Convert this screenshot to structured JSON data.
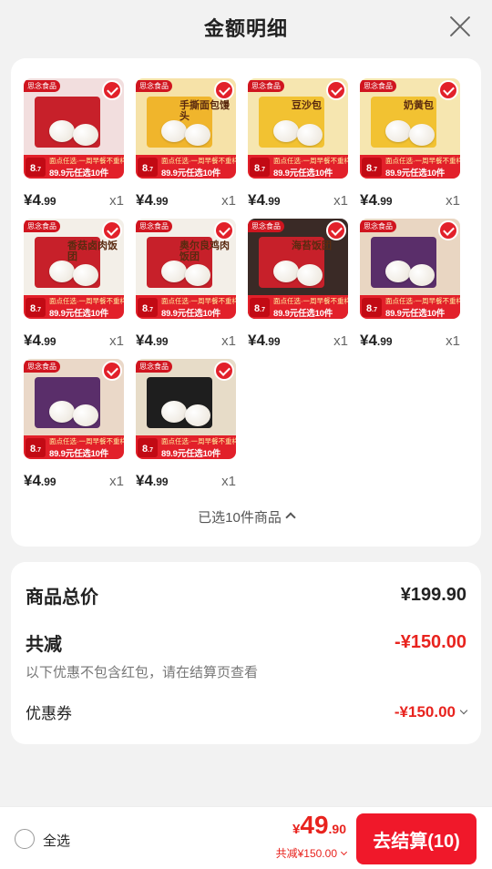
{
  "header": {
    "title": "金额明细"
  },
  "products": [
    {
      "brand": "思念食品",
      "pkg_label": "",
      "pkg_color": "#c7202a",
      "bg": "#f2dede",
      "price_tag": "8",
      "price_tag_dec": ".7",
      "promo_line1": "面点任选·一周早餐不重样",
      "promo_line2": "89.9元任选10件",
      "price_int": "¥4",
      "price_dec": ".99",
      "qty": "x1"
    },
    {
      "brand": "思念食品",
      "pkg_label": "手撕面包馒头",
      "pkg_color": "#f0b52c",
      "bg": "#f6e2a8",
      "price_tag": "8",
      "price_tag_dec": ".7",
      "promo_line1": "面点任选·一周早餐不重样",
      "promo_line2": "89.9元任选10件",
      "price_int": "¥4",
      "price_dec": ".99",
      "qty": "x1"
    },
    {
      "brand": "思念食品",
      "pkg_label": "豆沙包",
      "pkg_color": "#f2c232",
      "bg": "#f6e6b0",
      "price_tag": "8",
      "price_tag_dec": ".7",
      "promo_line1": "面点任选·一周早餐不重样",
      "promo_line2": "89.9元任选10件",
      "price_int": "¥4",
      "price_dec": ".99",
      "qty": "x1"
    },
    {
      "brand": "思念食品",
      "pkg_label": "奶黄包",
      "pkg_color": "#f2c232",
      "bg": "#f6e6b0",
      "price_tag": "8",
      "price_tag_dec": ".7",
      "promo_line1": "面点任选·一周早餐不重样",
      "promo_line2": "89.9元任选10件",
      "price_int": "¥4",
      "price_dec": ".99",
      "qty": "x1"
    },
    {
      "brand": "思念食品",
      "pkg_label": "香菇卤肉饭团",
      "pkg_color": "#c7202a",
      "bg": "#f3efe8",
      "price_tag": "8",
      "price_tag_dec": ".7",
      "promo_line1": "面点任选·一周早餐不重样",
      "promo_line2": "89.9元任选10件",
      "price_int": "¥4",
      "price_dec": ".99",
      "qty": "x1"
    },
    {
      "brand": "思念食品",
      "pkg_label": "奥尔良鸡肉饭团",
      "pkg_color": "#c7202a",
      "bg": "#f3efe8",
      "price_tag": "8",
      "price_tag_dec": ".7",
      "promo_line1": "面点任选·一周早餐不重样",
      "promo_line2": "89.9元任选10件",
      "price_int": "¥4",
      "price_dec": ".99",
      "qty": "x1"
    },
    {
      "brand": "思念食品",
      "pkg_label": "海苔饭团",
      "pkg_color": "#c7202a",
      "bg": "#3a2a26",
      "price_tag": "8",
      "price_tag_dec": ".7",
      "promo_line1": "面点任选·一周早餐不重样",
      "promo_line2": "89.9元任选10件",
      "price_int": "¥4",
      "price_dec": ".99",
      "qty": "x1"
    },
    {
      "brand": "思念食品",
      "pkg_label": "",
      "pkg_color": "#5a2e6a",
      "bg": "#e9d6c2",
      "price_tag": "8",
      "price_tag_dec": ".7",
      "promo_line1": "面点任选·一周早餐不重样",
      "promo_line2": "89.9元任选10件",
      "price_int": "¥4",
      "price_dec": ".99",
      "qty": "x1"
    },
    {
      "brand": "思念食品",
      "pkg_label": "",
      "pkg_color": "#5a2e6a",
      "bg": "#ead8c8",
      "price_tag": "8",
      "price_tag_dec": ".7",
      "promo_line1": "面点任选·一周早餐不重样",
      "promo_line2": "89.9元任选10件",
      "price_int": "¥4",
      "price_dec": ".99",
      "qty": "x1"
    },
    {
      "brand": "思念食品",
      "pkg_label": "",
      "pkg_color": "#1e1e1e",
      "bg": "#e7dcc8",
      "price_tag": "8",
      "price_tag_dec": ".7",
      "promo_line1": "面点任选·一周早餐不重样",
      "promo_line2": "89.9元任选10件",
      "price_int": "¥4",
      "price_dec": ".99",
      "qty": "x1"
    }
  ],
  "selected_text": "已选10件商品",
  "summary": {
    "total_label": "商品总价",
    "total_value": "¥199.90",
    "reduce_label": "共减",
    "reduce_value": "-¥150.00",
    "note": "以下优惠不包含红包，请在结算页查看",
    "coupon_label": "优惠券",
    "coupon_value": "-¥150.00"
  },
  "footer": {
    "select_all": "全选",
    "pay_yen": "¥",
    "pay_int": "49",
    "pay_frac": ".90",
    "reduced_text": "共减¥150.00",
    "checkout_label": "去结算(10)"
  },
  "colors": {
    "accent": "#e8231e",
    "checkout_bg": "#f0182a",
    "promo_bg": "#e2202a"
  }
}
